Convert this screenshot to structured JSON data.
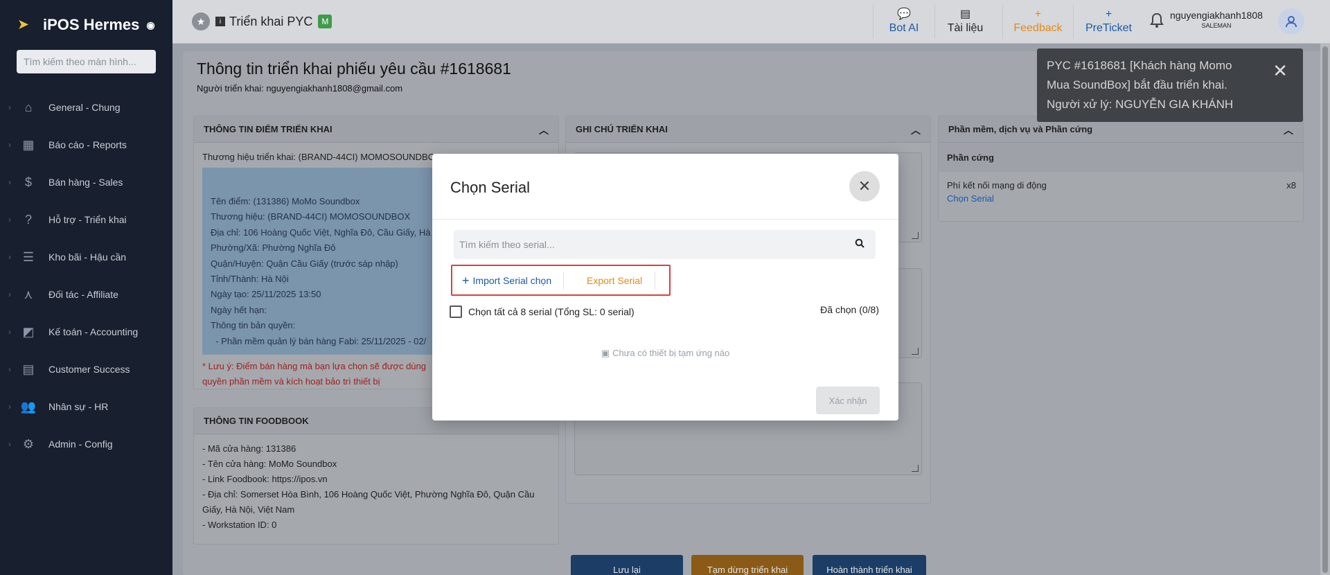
{
  "sidebar": {
    "brand": "iPOS Hermes",
    "search_placeholder": "Tìm kiếm theo màn hình...",
    "items": [
      {
        "label": "General - Chung",
        "icon": "home-icon"
      },
      {
        "label": "Báo cáo - Reports",
        "icon": "chart-icon"
      },
      {
        "label": "Bán hàng - Sales",
        "icon": "dollar-icon"
      },
      {
        "label": "Hỗ trợ - Triển khai",
        "icon": "help-icon"
      },
      {
        "label": "Kho bãi - Hậu cần",
        "icon": "list-icon"
      },
      {
        "label": "Đối tác - Affiliate",
        "icon": "network-icon"
      },
      {
        "label": "Kế toán - Accounting",
        "icon": "accounting-icon"
      },
      {
        "label": "Customer Success",
        "icon": "contact-icon"
      },
      {
        "label": "Nhân sự - HR",
        "icon": "people-icon"
      },
      {
        "label": "Admin - Config",
        "icon": "gear-icon"
      }
    ]
  },
  "topbar": {
    "title": "Triển khai PYC",
    "badge": "M",
    "buttons": [
      {
        "label": "Bot AI",
        "icon": "chat-icon",
        "color": "#1d58a8"
      },
      {
        "label": "Tài liệu",
        "icon": "docs-icon",
        "color": "#222222"
      },
      {
        "label": "Feedback",
        "icon": "plus-icon",
        "color": "#e38a17"
      },
      {
        "label": "PreTicket",
        "icon": "plus-icon",
        "color": "#1d58a8"
      }
    ],
    "username": "nguyengiakhanh1808",
    "role": "SALEMAN"
  },
  "page": {
    "title": "Thông tin triển khai phiếu yêu cầu #1618681",
    "subtitle": "Người triển khai: nguyengiakhanh1808@gmail.com"
  },
  "card_point": {
    "header": "THÔNG TIN ĐIỂM TRIỂN KHAI",
    "brand_line": "Thương hiệu triển khai: (BRAND-44CI) MOMOSOUNDBOX",
    "details": [
      "Tên điểm: (131386) MoMo Soundbox",
      "Thương hiệu: (BRAND-44CI) MOMOSOUNDBOX",
      "Địa chỉ: 106 Hoàng Quốc Việt, Nghĩa Đô, Cầu Giấy, Hà",
      "Phường/Xã: Phường Nghĩa Đô",
      "Quận/Huyện: Quận Cầu Giấy (trước sáp nhập)",
      "Tỉnh/Thành: Hà Nội",
      "Ngày tạo: 25/11/2025 13:50",
      "Ngày hết hạn:",
      "Thông tin bản quyền:",
      "  - Phần mềm quản lý bán hàng Fabi: 25/11/2025 - 02/"
    ],
    "warning_1": "* Lưu ý: Điểm bán hàng mà bạn lựa chọn sẽ được dùng",
    "warning_2": "quyền phần mềm và kích hoạt bảo trì thiết bị"
  },
  "card_foodbook": {
    "header": "THÔNG TIN FOODBOOK",
    "lines": [
      "- Mã cửa hàng: 131386",
      "- Tên cửa hàng: MoMo Soundbox",
      "- Link Foodbook: https://ipos.vn",
      "- Địa chỉ: Somerset Hòa Bình, 106 Hoàng Quốc Việt, Phường Nghĩa Đô, Quận Cầu",
      "Giấy, Hà Nội, Việt Nam",
      "- Workstation ID: 0"
    ]
  },
  "card_notes": {
    "header": "GHI CHÚ TRIỂN KHAI"
  },
  "card_hw": {
    "header": "Phần mềm, dịch vụ và Phần cứng",
    "section": "Phần cứng",
    "item_name": "Phí kết nối mạng di động",
    "item_qty": "x8",
    "item_link": "Chọn Serial"
  },
  "bottom_buttons": [
    {
      "label": "Lưu lại",
      "color": "#1b3d66"
    },
    {
      "label": "Tạm dừng triển khai",
      "color": "#8a5a16"
    },
    {
      "label": "Hoàn thành triển khai",
      "color": "#1b3d66"
    }
  ],
  "toast": {
    "line1": "PYC #1618681 [Khách hàng Momo",
    "line2": "Mua SoundBox] bắt đầu triển khai.",
    "line3": "Người xử lý: NGUYỄN GIA KHÁNH"
  },
  "modal": {
    "title": "Chọn Serial",
    "search_placeholder": "Tìm kiếm theo serial...",
    "import_label": "Import Serial chọn",
    "export_label": "Export Serial",
    "select_all_label": "Chọn tất cả 8 serial (Tổng SL: 0 serial)",
    "selected_count": "Đã chọn (0/8)",
    "empty_text": "Chưa có thiết bị tạm ứng nào",
    "confirm_label": "Xác nhận"
  }
}
